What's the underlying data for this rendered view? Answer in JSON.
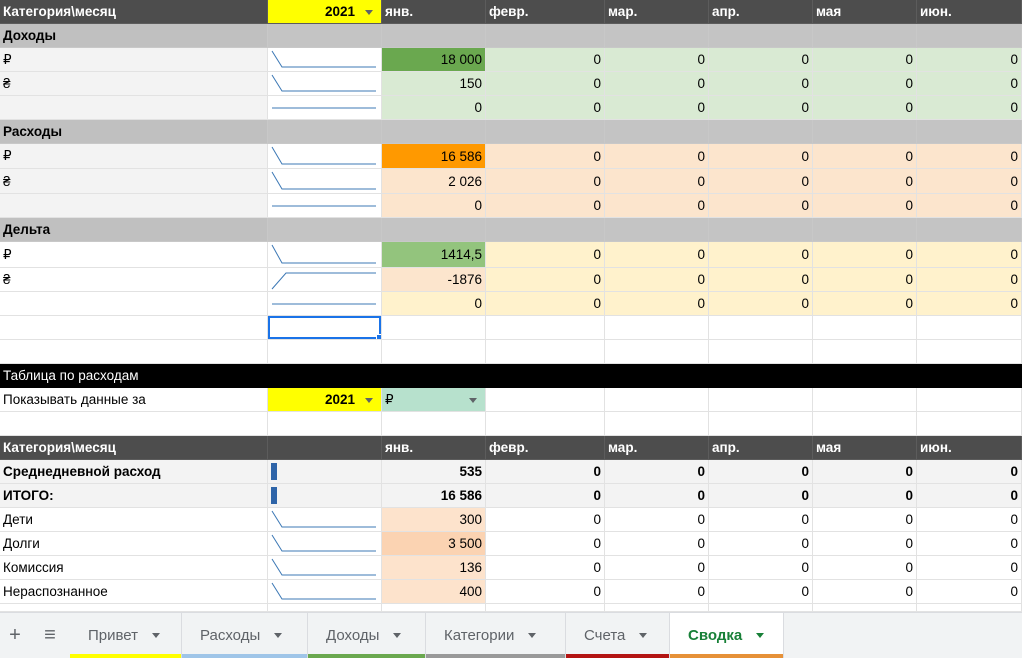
{
  "top_table": {
    "header": {
      "label": "Категория\\месяц",
      "year": "2021",
      "months": [
        "янв.",
        "февр.",
        "мар.",
        "апр.",
        "мая",
        "июн."
      ]
    },
    "sections": [
      {
        "title": "Доходы",
        "rows": [
          {
            "label": "₽",
            "values": [
              "18 000",
              "0",
              "0",
              "0",
              "0",
              "0"
            ]
          },
          {
            "label": "₴",
            "values": [
              "150",
              "0",
              "0",
              "0",
              "0",
              "0"
            ]
          },
          {
            "label": "",
            "values": [
              "0",
              "0",
              "0",
              "0",
              "0",
              "0"
            ]
          }
        ]
      },
      {
        "title": "Расходы",
        "rows": [
          {
            "label": "₽",
            "values": [
              "16 586",
              "0",
              "0",
              "0",
              "0",
              "0"
            ]
          },
          {
            "label": "₴",
            "values": [
              "2 026",
              "0",
              "0",
              "0",
              "0",
              "0"
            ]
          },
          {
            "label": "",
            "values": [
              "0",
              "0",
              "0",
              "0",
              "0",
              "0"
            ]
          }
        ]
      },
      {
        "title": "Дельта",
        "rows": [
          {
            "label": "₽",
            "values": [
              "1414,5",
              "0",
              "0",
              "0",
              "0",
              "0"
            ]
          },
          {
            "label": "₴",
            "values": [
              "-1876",
              "0",
              "0",
              "0",
              "0",
              "0"
            ]
          },
          {
            "label": "",
            "values": [
              "0",
              "0",
              "0",
              "0",
              "0",
              "0"
            ]
          }
        ]
      }
    ]
  },
  "expense_table": {
    "title": "Таблица по расходам",
    "filter_label": "Показывать данные за",
    "filter_year": "2021",
    "filter_currency": "₽",
    "header": {
      "label": "Категория\\месяц",
      "months": [
        "янв.",
        "февр.",
        "мар.",
        "апр.",
        "мая",
        "июн."
      ]
    },
    "summary_rows": [
      {
        "label": "Среднедневной расход",
        "values": [
          "535",
          "0",
          "0",
          "0",
          "0",
          "0"
        ]
      },
      {
        "label": "ИТОГО:",
        "values": [
          "16 586",
          "0",
          "0",
          "0",
          "0",
          "0"
        ]
      }
    ],
    "rows": [
      {
        "label": "Дети",
        "values": [
          "300",
          "0",
          "0",
          "0",
          "0",
          "0"
        ]
      },
      {
        "label": "Долги",
        "values": [
          "3 500",
          "0",
          "0",
          "0",
          "0",
          "0"
        ]
      },
      {
        "label": "Комиссия",
        "values": [
          "136",
          "0",
          "0",
          "0",
          "0",
          "0"
        ]
      },
      {
        "label": "Нераспознанное",
        "values": [
          "400",
          "0",
          "0",
          "0",
          "0",
          "0"
        ]
      }
    ]
  },
  "sheet_tabs": {
    "tabs": [
      {
        "label": "Привет",
        "color": "#ffff00"
      },
      {
        "label": "Расходы",
        "color": "#9fc5e8"
      },
      {
        "label": "Доходы",
        "color": "#6aa84f"
      },
      {
        "label": "Категории",
        "color": "#999999"
      },
      {
        "label": "Счета",
        "color": "#b31412"
      },
      {
        "label": "Сводка",
        "color": "#e69138",
        "active": true
      }
    ],
    "add_icon": "plus-icon",
    "menu_icon": "hamburger-icon"
  },
  "colors": {
    "income_jan_rub": "#6aa84f",
    "income_fill": "#d9ead3",
    "expense_jan_rub": "#ff9900",
    "expense_fill": "#fce5cd",
    "delta_positive": "#93c47d",
    "delta_negative": "#fce5cd",
    "delta_fill": "#fff2cc",
    "header_bg": "#4d4d4d",
    "year_highlight": "#ffff00",
    "sparkbar": "#2e64a8"
  }
}
